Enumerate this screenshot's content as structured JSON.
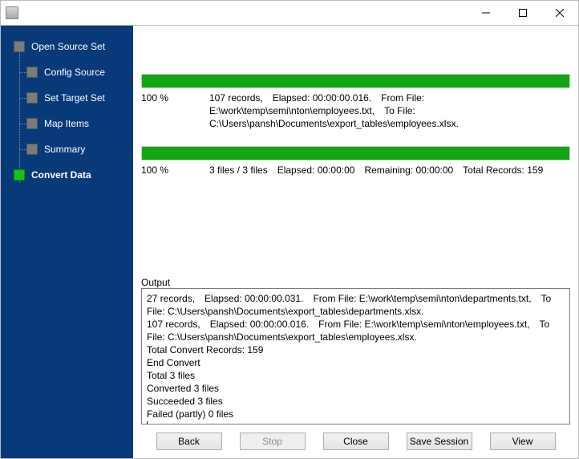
{
  "window": {
    "title": ""
  },
  "sidebar": {
    "items": [
      {
        "label": "Open Source Set"
      },
      {
        "label": "Config Source"
      },
      {
        "label": "Set Target Set"
      },
      {
        "label": "Map Items"
      },
      {
        "label": "Summary"
      },
      {
        "label": "Convert Data"
      }
    ]
  },
  "progress": {
    "file": {
      "percent_label": "100 %",
      "details": "107 records, Elapsed: 00:00:00.016. From File: E:\\work\\temp\\semi\\nton\\employees.txt, To File: C:\\Users\\pansh\\Documents\\export_tables\\employees.xlsx."
    },
    "total": {
      "percent_label": "100 %",
      "details": "3 files / 3 files Elapsed: 00:00:00 Remaining: 00:00:00 Total Records: 159"
    }
  },
  "output": {
    "label": "Output",
    "log": "27 records, Elapsed: 00:00:00.031. From File: E:\\work\\temp\\semi\\nton\\departments.txt, To File: C:\\Users\\pansh\\Documents\\export_tables\\departments.xlsx.\n107 records, Elapsed: 00:00:00.016. From File: E:\\work\\temp\\semi\\nton\\employees.txt, To File: C:\\Users\\pansh\\Documents\\export_tables\\employees.xlsx.\nTotal Convert Records: 159\nEnd Convert\nTotal 3 files\nConverted 3 files\nSucceeded 3 files\nFailed (partly) 0 files"
  },
  "buttons": {
    "back": "Back",
    "stop": "Stop",
    "close": "Close",
    "save_session": "Save Session",
    "view": "View"
  }
}
